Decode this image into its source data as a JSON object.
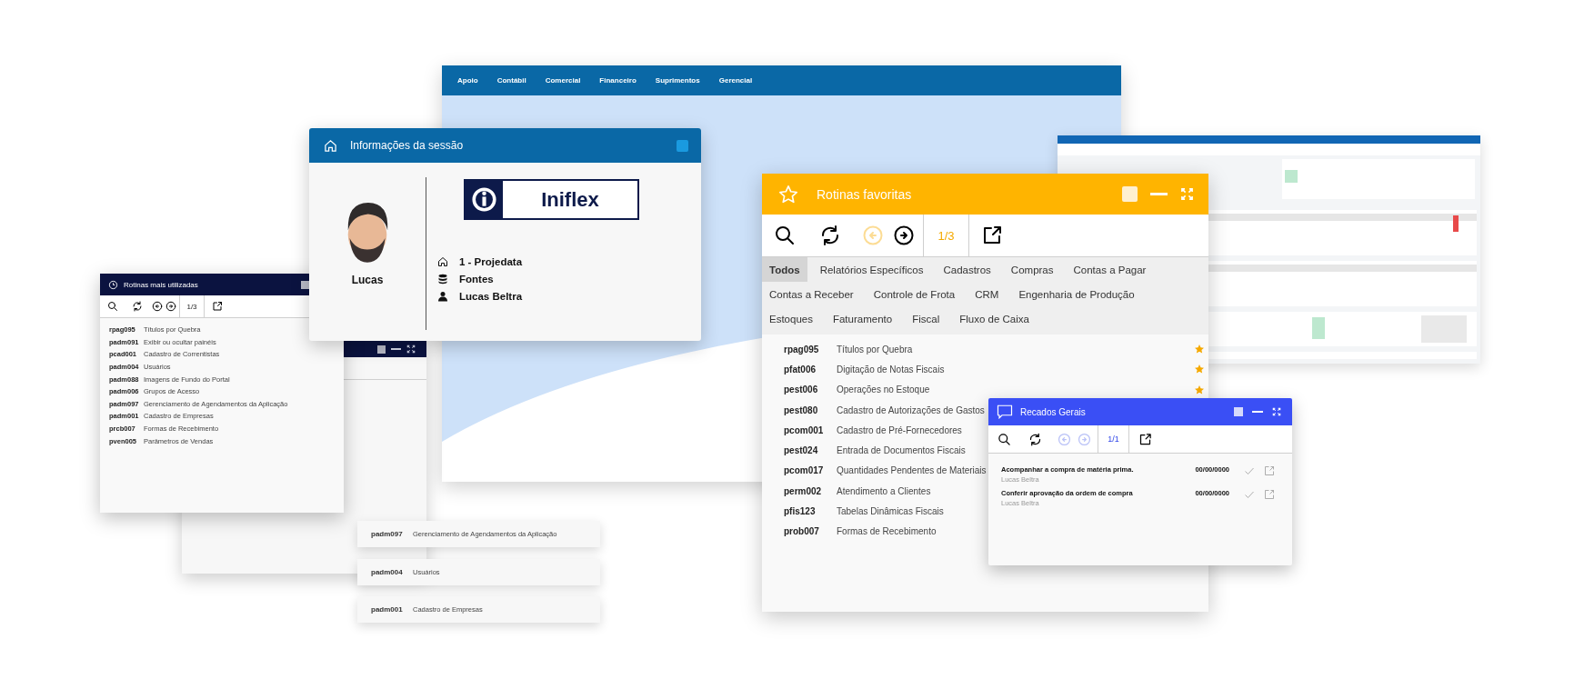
{
  "main_window": {
    "menu": [
      "Apoio",
      "Contábil",
      "Comercial",
      "Financeiro",
      "Suprimentos",
      "Gerencial"
    ]
  },
  "session": {
    "title": "Informações da sessão",
    "user": "Lucas",
    "logo": "Iniflex",
    "info": [
      {
        "kind": "company",
        "text": "1 - Projedata"
      },
      {
        "kind": "database",
        "text": "Fontes"
      },
      {
        "kind": "user",
        "text": "Lucas Beltra"
      }
    ]
  },
  "most_used": {
    "title": "Rotinas mais utilizadas",
    "toolbar": {
      "page": "1/3",
      "prev_disabled": false,
      "next_disabled": false
    },
    "rows": [
      {
        "code": "rpag095",
        "name": "Títulos por Quebra"
      },
      {
        "code": "padm091",
        "name": "Exibir ou ocultar painéis"
      },
      {
        "code": "pcad001",
        "name": "Cadastro de Correntistas"
      },
      {
        "code": "padm004",
        "name": "Usuários"
      },
      {
        "code": "padm088",
        "name": "Imagens de Fundo do Portal"
      },
      {
        "code": "padm006",
        "name": "Grupos de Acesso"
      },
      {
        "code": "padm097",
        "name": "Gerenciamento de Agendamentos da Aplicação"
      },
      {
        "code": "padm001",
        "name": "Cadastro de Empresas"
      },
      {
        "code": "prcb007",
        "name": "Formas de Recebimento"
      },
      {
        "code": "pven005",
        "name": "Parâmetros de Vendas"
      }
    ]
  },
  "pinned_rows": [
    {
      "code": "padm097",
      "name": "Gerenciamento de Agendamentos da Aplicação"
    },
    {
      "code": "padm004",
      "name": "Usuários"
    },
    {
      "code": "padm001",
      "name": "Cadastro de Empresas"
    }
  ],
  "favorites": {
    "title": "Rotinas favoritas",
    "toolbar": {
      "page": "1/3",
      "prev_disabled": true,
      "next_disabled": false
    },
    "tabs": [
      {
        "label": "Todos",
        "selected": true
      },
      {
        "label": "Relatórios Específicos",
        "selected": false
      },
      {
        "label": "Cadastros",
        "selected": false
      },
      {
        "label": "Compras",
        "selected": false
      },
      {
        "label": "Contas a Pagar",
        "selected": false
      },
      {
        "label": "Contas a Receber",
        "selected": false
      },
      {
        "label": "Controle de Frota",
        "selected": false
      },
      {
        "label": "CRM",
        "selected": false
      },
      {
        "label": "Engenharia de Produção",
        "selected": false
      },
      {
        "label": "Estoques",
        "selected": false
      },
      {
        "label": "Faturamento",
        "selected": false
      },
      {
        "label": "Fiscal",
        "selected": false
      },
      {
        "label": "Fluxo de Caixa",
        "selected": false
      }
    ],
    "rows": [
      {
        "code": "rpag095",
        "name": "Títulos por Quebra",
        "starred": true
      },
      {
        "code": "pfat006",
        "name": "Digitação de Notas Fiscais",
        "starred": true
      },
      {
        "code": "pest006",
        "name": "Operações no Estoque",
        "starred": true
      },
      {
        "code": "pest080",
        "name": "Cadastro de Autorizações de Gastos",
        "starred": false
      },
      {
        "code": "pcom001",
        "name": "Cadastro de Pré-Fornecedores",
        "starred": false
      },
      {
        "code": "pest024",
        "name": "Entrada de Documentos Fiscais",
        "starred": false
      },
      {
        "code": "pcom017",
        "name": "Quantidades Pendentes de Materiais",
        "starred": false
      },
      {
        "code": "perm002",
        "name": "Atendimento a Clientes",
        "starred": false
      },
      {
        "code": "pfis123",
        "name": "Tabelas Dinâmicas Fiscais",
        "starred": false
      },
      {
        "code": "prob007",
        "name": "Formas de Recebimento",
        "starred": false
      }
    ]
  },
  "messages": {
    "title": "Recados Gerais",
    "toolbar": {
      "page": "1/1",
      "prev_disabled": true,
      "next_disabled": true
    },
    "items": [
      {
        "text": "Acompanhar a compra de matéria prima.",
        "author": "Lucas Beltra",
        "date": "00/00/0000"
      },
      {
        "text": "Conferir aprovação da ordem de compra",
        "author": "Lucas Beltra",
        "date": "00/00/0000"
      }
    ]
  }
}
